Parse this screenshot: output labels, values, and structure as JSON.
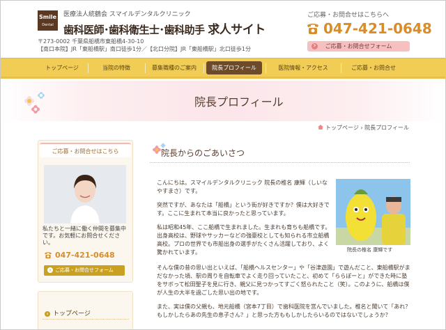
{
  "header": {
    "logo_word": "Smile",
    "logo_sub": "Dental Clinic",
    "corp": "医療法人統鶴会 スマイルデンタルクリニック",
    "headline_a": "歯科医師･歯科衛生士･歯科助手",
    "headline_b": "求人サイト",
    "addr_line1": "〒273-0002 千葉県船橋市東船橋4-30-10",
    "addr_line2": "【南口本院】JR「東船橋駅」南口徒歩1分／【北口分院】JR「東船橋駅」北口徒歩1分",
    "contact_label": "ご応募・お問合せはこちらへ",
    "phone": "047-421-0648",
    "form_button": "ご応募・お問合せフォーム"
  },
  "nav": {
    "items": [
      {
        "label": "トップページ"
      },
      {
        "label": "当院の特徴"
      },
      {
        "label": "募集職種のご案内"
      },
      {
        "label": "院長プロフィール"
      },
      {
        "label": "医院情報・アクセス"
      },
      {
        "label": "ご応募・お問合せ"
      }
    ],
    "active_index": 3
  },
  "banner": {
    "title": "院長プロフィール"
  },
  "breadcrumb": {
    "text": "トップページ › 院長プロフィール"
  },
  "sidebar": {
    "head": "ご応募・お問合せはこちら",
    "text": "私たちと一緒に働く仲間を募集中です。お気軽にお問合せください。",
    "phone": "047-421-0648",
    "form_button": "ご応募・お問合せフォーム",
    "menu_item": "トップページ"
  },
  "content": {
    "heading": "院長からのごあいさつ",
    "p1": "こんにちは。スマイルデンタルクリニック 院長の椎名 康輝（しいなやすまさ）です。",
    "p2": "突然ですが、あなたは「船橋」という街が好きですか？僕は大好きです。ここに生まれて本当に良かったと思っています。",
    "p3": "私は昭和45年、ここ船橋で生まれました。生まれも育ちも船橋です。出身高校は、野球やサッカーなどの強豪校としても知られる市立船橋高校。プロの世界でも市船出身の選手がたくさん活躍しており、よく驚かれています。",
    "p4": "そんな僕の昔の思い出といえば、「船橋ヘルスセンター」や「谷津遊園」で遊んだこと、東船橋駅がまだなかった頃、駅の周りを自転車でよく走り回っていたこと、初めて「ららぽーと」ができた時に塾をサボって松田聖子を見に行き、親父に見つかってすごく怒られたこと（笑）。このように、船橋は僕が人生の大半を過ごした思い出の地です。",
    "p5": "また、実は僕の父親も、地元船橋（宮本7丁目）で歯科医院を営んでいました。椎名と聞いて「あれ？もしかしたらあの先生の息子さん？」と思った方ももしかしたらいるのではないでしょうか？",
    "photo_caption": "院長の椎名 康輝です"
  }
}
